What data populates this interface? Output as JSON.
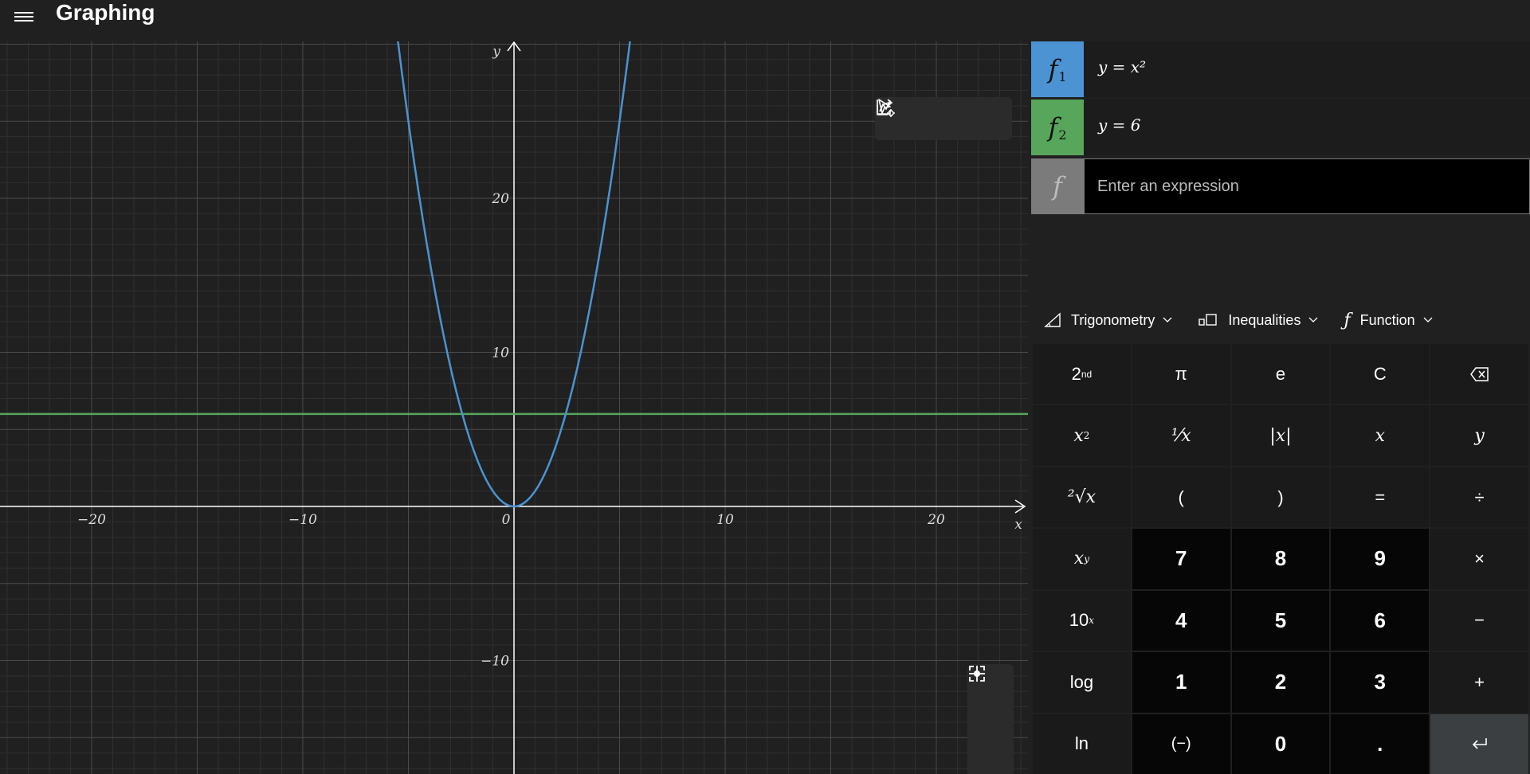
{
  "app": {
    "title": "Graphing"
  },
  "graph": {
    "x_axis_label": "x",
    "y_axis_label": "y",
    "x_ticks": [
      "−20",
      "−10",
      "0",
      "10",
      "20"
    ],
    "y_ticks": [
      "20",
      "10",
      "−10"
    ],
    "colors": {
      "f1": "#4b93d2",
      "f2": "#57a65b",
      "axis": "#ffffff",
      "grid_major": "#4a4a4a",
      "grid_minor": "#2f2f2f"
    }
  },
  "toolbar": {
    "icons": [
      "cursor-icon",
      "share-icon",
      "graph-options-icon"
    ]
  },
  "zoom": {
    "icons": [
      "zoom-in-icon",
      "zoom-out-icon",
      "fit-to-screen-icon"
    ]
  },
  "expressions": [
    {
      "symbol": "f",
      "index": "1",
      "text": "y = x²",
      "color": "#4b93d2"
    },
    {
      "symbol": "f",
      "index": "2",
      "text": "y = 6",
      "color": "#57a65b"
    }
  ],
  "new_expression": {
    "symbol": "f",
    "placeholder": "Enter an expression",
    "color": "#7b7b7b"
  },
  "function_tabs": [
    {
      "label": "Trigonometry",
      "icon": "triangle-icon"
    },
    {
      "label": "Inequalities",
      "icon": "inequality-icon"
    },
    {
      "label": "Function",
      "icon": "function-icon"
    }
  ],
  "keypad": {
    "row1": [
      "2nd",
      "π",
      "e",
      "C",
      "backspace-icon"
    ],
    "row2": [
      "x²",
      "⅟x",
      "|x|",
      "x",
      "y"
    ],
    "row3": [
      "²√x",
      "(",
      ")",
      "=",
      "÷"
    ],
    "row4": [
      "xʸ",
      "7",
      "8",
      "9",
      "×"
    ],
    "row5": [
      "10ˣ",
      "4",
      "5",
      "6",
      "−"
    ],
    "row6": [
      "log",
      "1",
      "2",
      "3",
      "+"
    ],
    "row7": [
      "ln",
      "(−)",
      "0",
      ".",
      "enter-icon"
    ]
  }
}
